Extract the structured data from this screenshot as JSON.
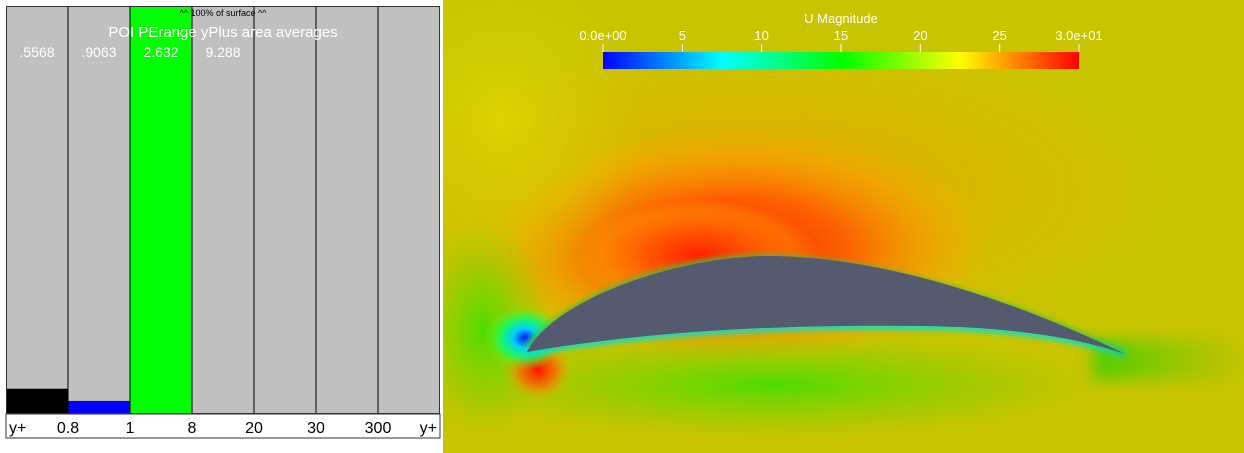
{
  "histogram": {
    "chart_data": {
      "type": "bar",
      "title": "POI PErange yPlus area averages",
      "subtitle": "^^ 100% of surface ^^",
      "x_edge_labels": [
        "0.8",
        "1",
        "8",
        "20",
        "30",
        "300"
      ],
      "axis_end_label": "y+",
      "bin_averages": [
        ".5568",
        ".9063",
        "2.632",
        "9.288",
        "",
        "",
        ""
      ],
      "bins": [
        {
          "range": "< 0.8",
          "area_fraction": 0.062,
          "color": "#000000"
        },
        {
          "range": "0.8 - 1",
          "area_fraction": 0.032,
          "color": "#0000ff"
        },
        {
          "range": "1 - 8",
          "area_fraction": 1.0,
          "color": "#00ff00"
        },
        {
          "range": "8 - 20",
          "area_fraction": 0,
          "color": "#00c0c0"
        },
        {
          "range": "20 - 30",
          "area_fraction": 0,
          "color": "#ffff00"
        },
        {
          "range": "30 - 300",
          "area_fraction": 0,
          "color": "#ff8000"
        },
        {
          "range": "> 300",
          "area_fraction": 0,
          "color": "#ff0000"
        }
      ],
      "ylim": [
        0,
        1
      ],
      "background": "#c0c0c0"
    }
  },
  "field_view": {
    "colorbar": {
      "title": "U Magnitude",
      "tick_labels": [
        "0.0e+00",
        "5",
        "10",
        "15",
        "20",
        "25",
        "3.0e+01"
      ],
      "range": [
        0,
        30
      ],
      "colormap": [
        "#0000ff",
        "#00ffff",
        "#00ff00",
        "#ffff00",
        "#ff0000"
      ]
    },
    "freestream_color": "#c8c400",
    "surface_color": "#555a6e"
  }
}
